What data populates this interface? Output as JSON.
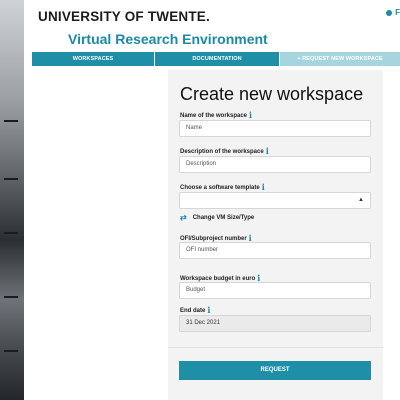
{
  "header": {
    "university": "UNIVERSITY OF TWENTE.",
    "subtitle": "Virtual Research Environment",
    "top_right_label": "F"
  },
  "nav": {
    "workspaces": "WORKSPACES",
    "documentation": "DOCUMENTATION",
    "request": "+ REQUEST NEW WORKSPACE"
  },
  "form": {
    "title": "Create new workspace",
    "name_label": "Name of the workspace",
    "name_placeholder": "Name",
    "description_label": "Description of the workspace",
    "description_placeholder": "Description",
    "template_label": "Choose a software template",
    "template_value": "",
    "vm_toggle": "Change VM Size/Type",
    "ofi_label": "OFI/Subproject number",
    "ofi_placeholder": "OFI number",
    "budget_label": "Workspace budget in euro",
    "budget_placeholder": "Budget",
    "end_date_label": "End date",
    "end_date_value": "31 Dec 2021",
    "submit": "REQUEST"
  },
  "icons": {
    "info": "info-icon",
    "swap": "swap-arrows-icon",
    "caret": "select-caret-icon"
  },
  "colors": {
    "accent": "#1f8fa8",
    "accent_light": "#a7d5df",
    "panel": "#f3f3f3"
  }
}
